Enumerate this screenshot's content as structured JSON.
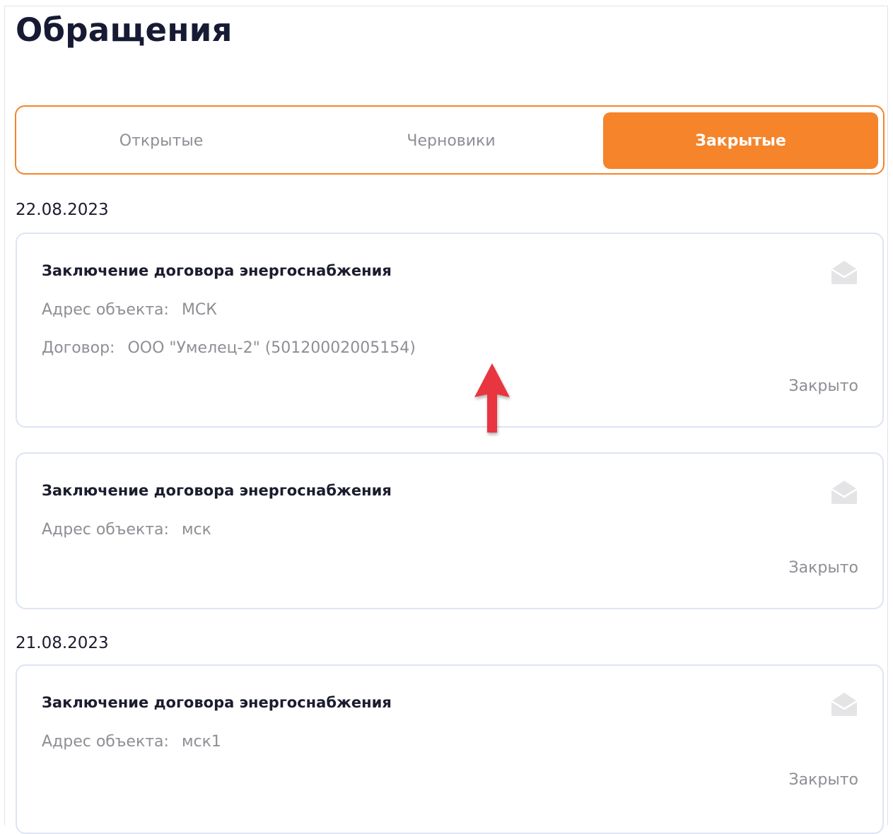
{
  "page": {
    "title": "Обращения"
  },
  "tabs": [
    {
      "label": "Открытые",
      "active": false
    },
    {
      "label": "Черновики",
      "active": false
    },
    {
      "label": "Закрытые",
      "active": true
    }
  ],
  "colors": {
    "accent": "#f5842a",
    "title": "#161a33",
    "muted_text": "#8e8e95",
    "card_border": "#dde4f4",
    "annotation_arrow": "#e8353f"
  },
  "groups": [
    {
      "date": "22.08.2023",
      "requests": [
        {
          "title": "Заключение договора энергоснабжения",
          "address_label": "Адрес объекта:",
          "address_value": "МСК",
          "contract_label": "Договор:",
          "contract_value": "ООО \"Умелец-2\" (50120002005154)",
          "status": "Закрыто",
          "icon": "envelope-open-icon"
        },
        {
          "title": "Заключение договора энергоснабжения",
          "address_label": "Адрес объекта:",
          "address_value": "мск",
          "status": "Закрыто",
          "icon": "envelope-open-icon"
        }
      ]
    },
    {
      "date": "21.08.2023",
      "requests": [
        {
          "title": "Заключение договора энергоснабжения",
          "address_label": "Адрес объекта:",
          "address_value": "мск1",
          "status": "Закрыто",
          "icon": "envelope-open-icon"
        }
      ]
    }
  ],
  "annotation": {
    "icon": "red-arrow-up-icon"
  }
}
